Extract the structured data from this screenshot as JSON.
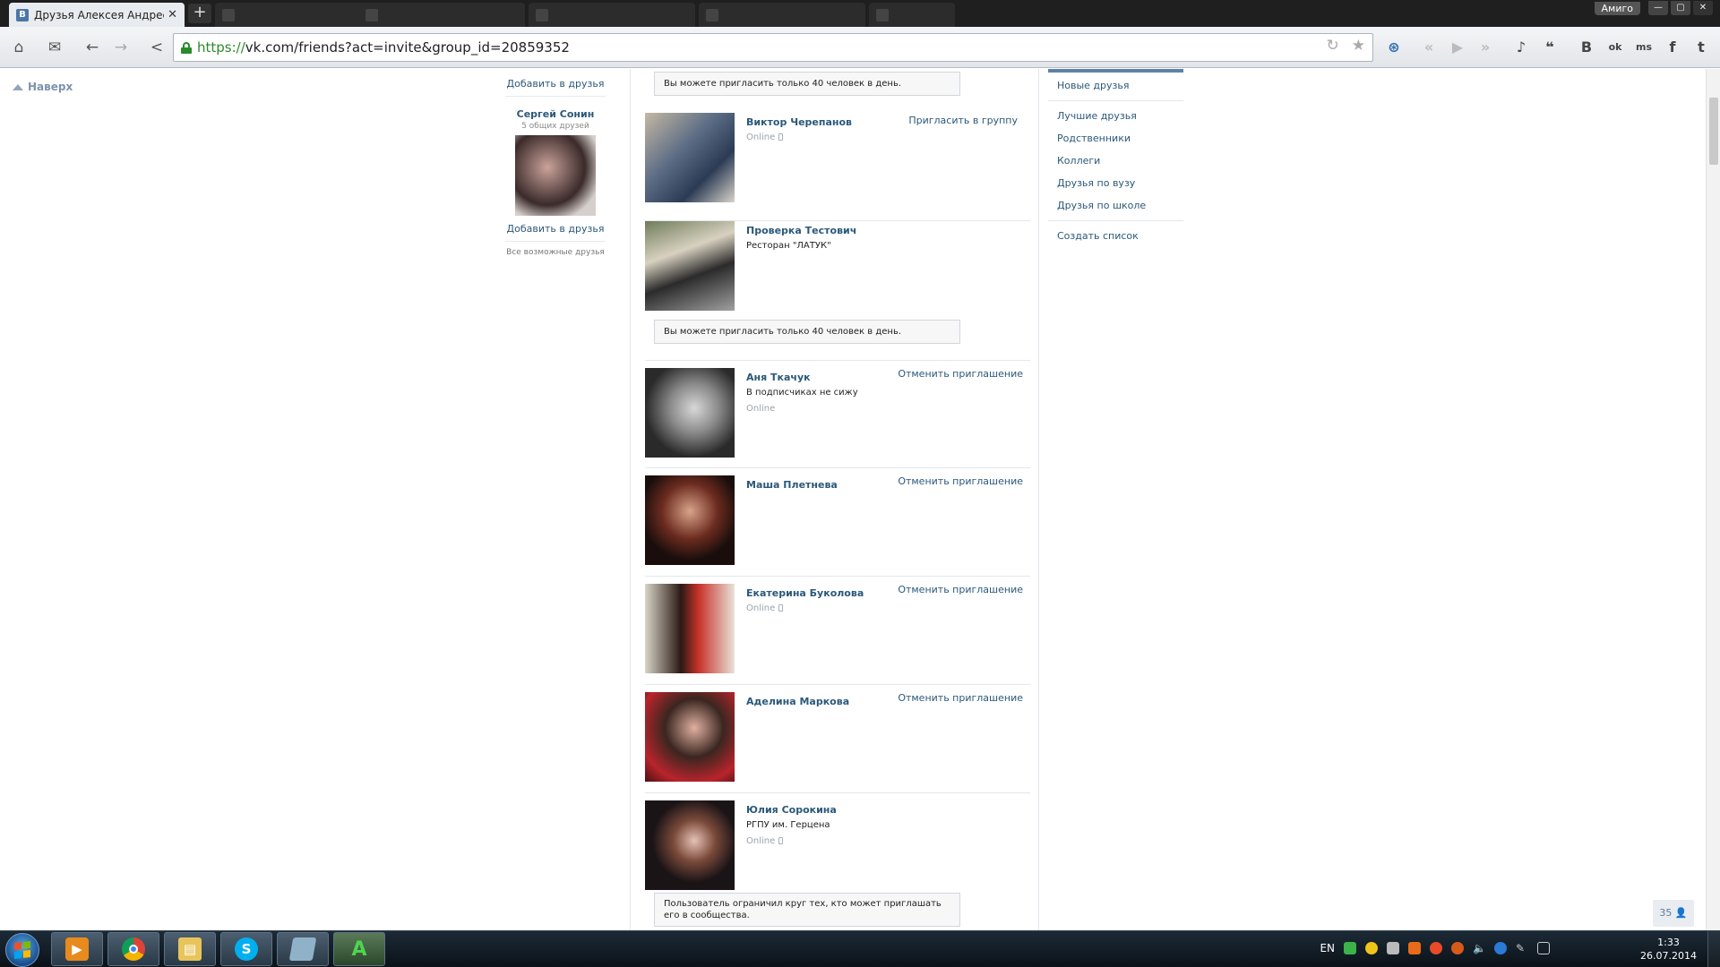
{
  "browser": {
    "active_tab": {
      "title": "Друзья Алексея Андреева",
      "favicon": "В"
    },
    "background_tabs": [
      "",
      "",
      "",
      "",
      ""
    ],
    "profile": "Амиго",
    "url": {
      "scheme": "https://",
      "rest": "vk.com/friends?act=invite&group_id=20859352"
    },
    "extensions": [
      "В",
      "ok",
      "ms",
      "f",
      "t"
    ]
  },
  "page": {
    "to_top": "Наверх",
    "suggest": {
      "add_top": "Добавить в друзья",
      "name": "Сергей Сонин",
      "mutual": "5 общих друзей",
      "add_bottom": "Добавить в друзья",
      "all": "Все возможные друзья"
    },
    "notices": {
      "top": "Вы можете пригласить только 40 человек в день.",
      "middle": "Вы можете пригласить только 40 человек в день.",
      "bottom": "Пользователь ограничил круг тех, кто может приглашать его в сообщества."
    },
    "people": [
      {
        "name": "Виктор Черепанов",
        "sub": "",
        "status": "Online",
        "mobile": true,
        "action": "Пригласить в группу"
      },
      {
        "name": "Проверка Тестович",
        "sub": "Ресторан \"ЛАТУК\"",
        "status": "",
        "mobile": false,
        "action": ""
      },
      {
        "name": "Аня Ткачук",
        "sub": "В подписчиках не сижу",
        "status": "Online",
        "mobile": false,
        "action": "Отменить приглашение"
      },
      {
        "name": "Маша Плетнева",
        "sub": "",
        "status": "",
        "mobile": false,
        "action": "Отменить приглашение"
      },
      {
        "name": "Екатерина Буколова",
        "sub": "",
        "status": "Online",
        "mobile": true,
        "action": "Отменить приглашение"
      },
      {
        "name": "Аделина Маркова",
        "sub": "",
        "status": "",
        "mobile": false,
        "action": "Отменить приглашение"
      },
      {
        "name": "Юлия Сорокина",
        "sub": "РГПУ им. Герцена",
        "status": "Online",
        "mobile": true,
        "action": ""
      }
    ],
    "menu": {
      "new_friends": "Новые друзья",
      "best": "Лучшие друзья",
      "relatives": "Родственники",
      "colleagues": "Коллеги",
      "uni": "Друзья по вузу",
      "school": "Друзья по школе",
      "create": "Создать список"
    },
    "online_count": "35"
  },
  "taskbar": {
    "lang": "EN",
    "time": "1:33",
    "date": "26.07.2014"
  },
  "colors": {
    "vk_link": "#2b587a",
    "vk_accent": "#5e81a8",
    "secure_green": "#2a8a2a"
  }
}
